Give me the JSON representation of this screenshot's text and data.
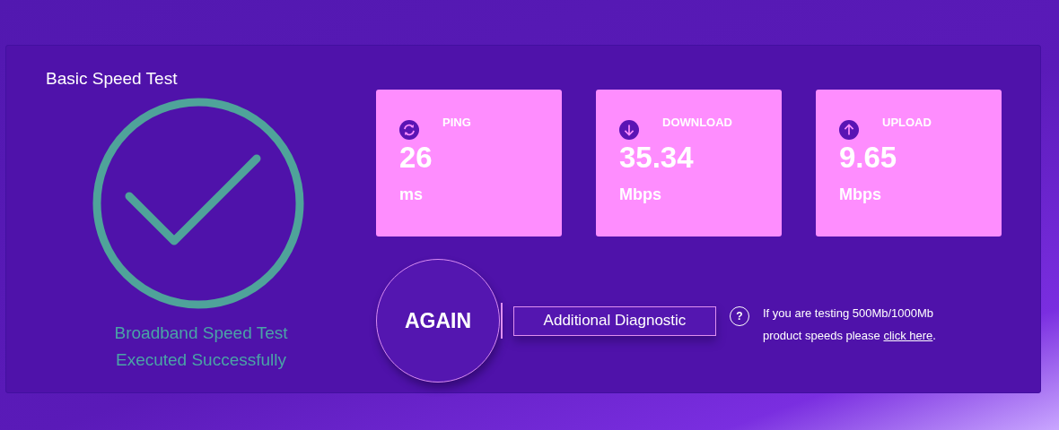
{
  "title": "Basic Speed Test",
  "status": {
    "succeeded": true,
    "lines": [
      "Broadband Speed Test",
      "Executed Successfully"
    ]
  },
  "metrics": [
    {
      "kind": "ping",
      "label": "PING",
      "value": "26",
      "unit": "ms"
    },
    {
      "kind": "download",
      "label": "DOWNLOAD",
      "value": "35.34",
      "unit": "Mbps"
    },
    {
      "kind": "upload",
      "label": "UPLOAD",
      "value": "9.65",
      "unit": "Mbps"
    }
  ],
  "again_button": "AGAIN",
  "diagnostic_button": "Additional Diagnostic",
  "help_icon": "?",
  "note": {
    "text": "If you are testing 500Mb/1000Mb product speeds please",
    "link": "click here",
    "end": "."
  }
}
